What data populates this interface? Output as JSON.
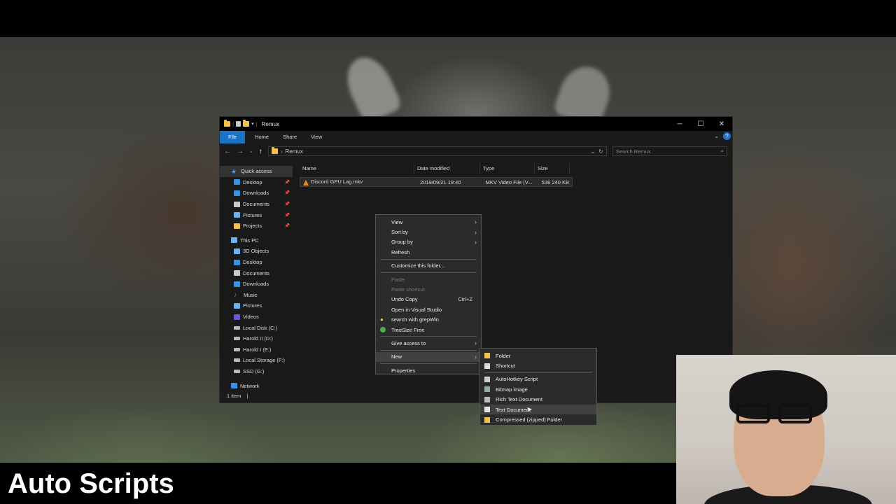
{
  "window": {
    "title": "Remux",
    "controls": {
      "minimize": "─",
      "maximize": "☐",
      "close": "✕"
    }
  },
  "ribbon": {
    "tabs": [
      "File",
      "Home",
      "Share",
      "View"
    ]
  },
  "address": {
    "path": "Remux",
    "search_placeholder": "Search Remux"
  },
  "nav": {
    "quick_access": {
      "label": "Quick access",
      "items": [
        {
          "label": "Desktop",
          "icon": "desktop-icon",
          "pinned": true
        },
        {
          "label": "Downloads",
          "icon": "downloads-icon",
          "pinned": true
        },
        {
          "label": "Documents",
          "icon": "documents-icon",
          "pinned": true
        },
        {
          "label": "Pictures",
          "icon": "pictures-icon",
          "pinned": true
        },
        {
          "label": "Projects",
          "icon": "folder-icon",
          "pinned": true
        }
      ]
    },
    "this_pc": {
      "label": "This PC",
      "items": [
        {
          "label": "3D Objects",
          "icon": "3d-objects-icon"
        },
        {
          "label": "Desktop",
          "icon": "desktop-icon"
        },
        {
          "label": "Documents",
          "icon": "documents-icon"
        },
        {
          "label": "Downloads",
          "icon": "downloads-icon"
        },
        {
          "label": "Music",
          "icon": "music-icon"
        },
        {
          "label": "Pictures",
          "icon": "pictures-icon"
        },
        {
          "label": "Videos",
          "icon": "videos-icon"
        },
        {
          "label": "Local Disk (C:)",
          "icon": "drive-icon"
        },
        {
          "label": "Harold II (D:)",
          "icon": "drive-icon"
        },
        {
          "label": "Harold I (E:)",
          "icon": "drive-icon"
        },
        {
          "label": "Local Storage (F:)",
          "icon": "drive-icon"
        },
        {
          "label": "SSD (G:)",
          "icon": "drive-icon"
        }
      ]
    },
    "network": {
      "label": "Network"
    }
  },
  "columns": [
    "Name",
    "Date modified",
    "Type",
    "Size"
  ],
  "files": [
    {
      "name": "Discord GPU Lag.mkv",
      "date": "2019/09/21 19:40",
      "type": "MKV Video File (V...",
      "size": "536 240 KB"
    }
  ],
  "status": {
    "count": "1 item",
    "sep": "|"
  },
  "context_menu": {
    "group1": [
      "View",
      "Sort by",
      "Group by",
      "Refresh"
    ],
    "customize": "Customize this folder...",
    "paste": "Paste",
    "paste_shortcut": "Paste shortcut",
    "undo": "Undo Copy",
    "undo_shortcut": "Ctrl+Z",
    "open_vs": "Open in Visual Studio",
    "grepwin": "search with grepWin",
    "treesize": "TreeSize Free",
    "give_access": "Give access to",
    "new": "New",
    "properties": "Properties"
  },
  "new_menu": {
    "items": [
      "Folder",
      "Shortcut",
      "AutoHotkey Script",
      "Bitmap image",
      "Rich Text Document",
      "Text Document",
      "Compressed (zipped) Folder"
    ]
  },
  "caption": "Auto Scripts"
}
